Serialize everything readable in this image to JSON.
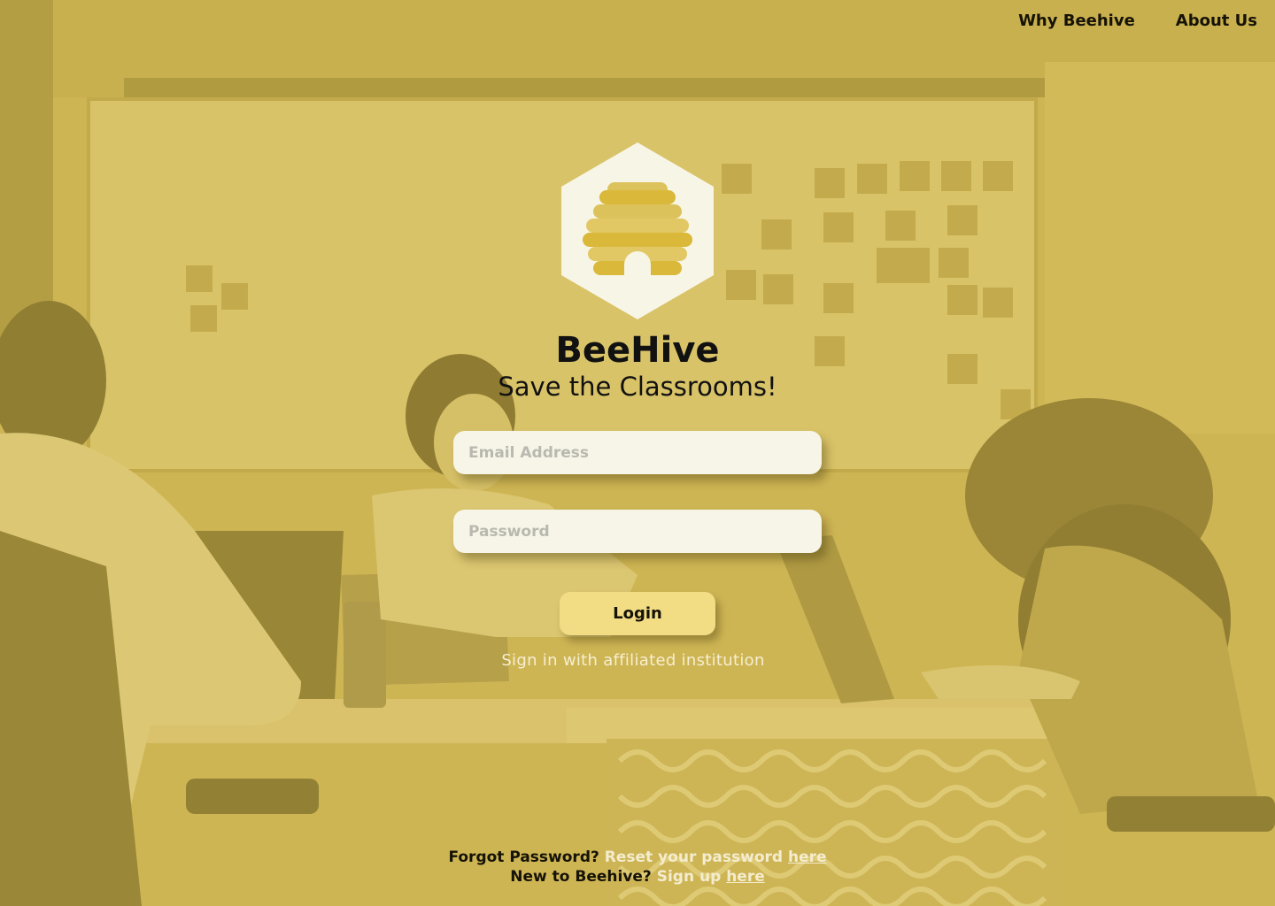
{
  "nav": {
    "why_label": "Why Beehive",
    "about_label": "About Us"
  },
  "brand": {
    "title": "BeeHive",
    "tagline": "Save the Classrooms!"
  },
  "form": {
    "email_placeholder": "Email Address",
    "password_placeholder": "Password",
    "login_label": "Login",
    "sso_label": "Sign in with affiliated institution"
  },
  "footer": {
    "forgot_question": "Forgot Password?",
    "forgot_text": "Reset your password",
    "forgot_link": "here",
    "signup_question": "New to Beehive?",
    "signup_text": "Sign up",
    "signup_link": "here"
  },
  "colors": {
    "overlay": "#cdb45a",
    "field_bg": "#f7f5e8",
    "button_bg": "#f2dd85",
    "hive": "#d9b83a",
    "link_light": "#f4ecce"
  },
  "icons": {
    "logo": "beehive-hexagon-logo"
  }
}
